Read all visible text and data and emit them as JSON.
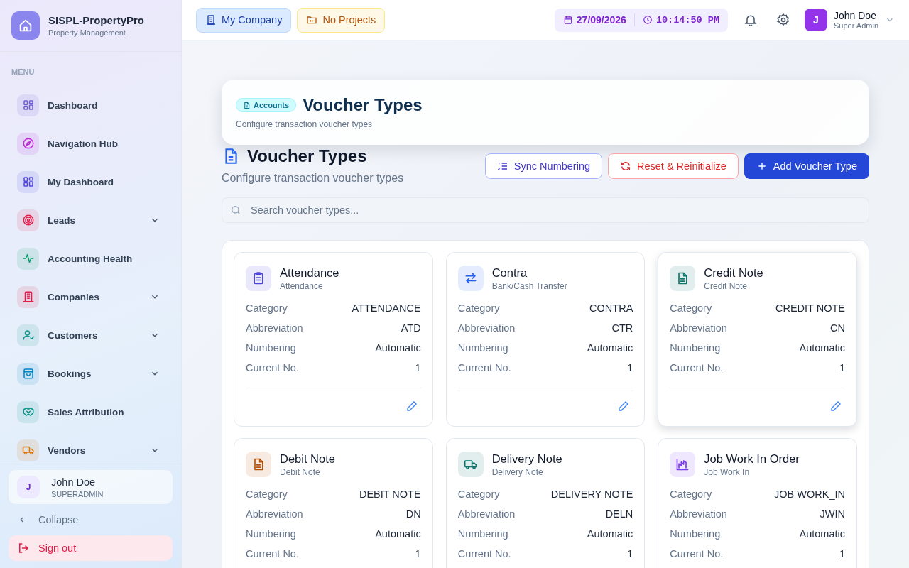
{
  "brand": {
    "name": "SISPL-PropertyPro",
    "subtitle": "Property Management"
  },
  "menu_label": "MENU",
  "sidebar": {
    "items": [
      {
        "label": "Dashboard",
        "color": "#6d5bd0",
        "expandable": false
      },
      {
        "label": "Navigation Hub",
        "color": "#c026d3",
        "expandable": false
      },
      {
        "label": "My Dashboard",
        "color": "#4f46e5",
        "expandable": false
      },
      {
        "label": "Leads",
        "color": "#e11d48",
        "expandable": true
      },
      {
        "label": "Accounting Health",
        "color": "#059669",
        "expandable": false
      },
      {
        "label": "Companies",
        "color": "#e11d48",
        "expandable": true
      },
      {
        "label": "Customers",
        "color": "#0d9488",
        "expandable": true
      },
      {
        "label": "Bookings",
        "color": "#0284c7",
        "expandable": true
      },
      {
        "label": "Sales Attribution",
        "color": "#0d9488",
        "expandable": false
      },
      {
        "label": "Vendors",
        "color": "#d97706",
        "expandable": true
      }
    ]
  },
  "sidebar_user": {
    "initial": "J",
    "name": "John Doe",
    "role": "SUPERADMIN"
  },
  "collapse": "Collapse",
  "sign_out": "Sign out",
  "topbar": {
    "company": "My Company",
    "project": "No Projects",
    "date": "27/09/2026",
    "time": "10:14:50 PM",
    "user": {
      "initial": "J",
      "name": "John Doe",
      "role": "Super Admin"
    }
  },
  "header_card": {
    "badge": "Accounts",
    "title": "Voucher Types",
    "subtitle": "Configure transaction voucher types"
  },
  "page": {
    "title": "Voucher Types",
    "subtitle": "Configure transaction voucher types",
    "buttons": [
      "Sync Numbering",
      "Reset & Reinitialize",
      "Add Voucher Type"
    ],
    "search": {
      "placeholder": "Search voucher types..."
    }
  },
  "vouchers": [
    {
      "name": "Attendance",
      "subtitle": "Attendance",
      "color": "#4f46e5",
      "highlighted": false,
      "fields": [
        {
          "label": "Category",
          "value": "ATTENDANCE"
        },
        {
          "label": "Abbreviation",
          "value": "ATD"
        },
        {
          "label": "Numbering",
          "value": "Automatic"
        },
        {
          "label": "Current No.",
          "value": "1"
        }
      ]
    },
    {
      "name": "Contra",
      "subtitle": "Bank/Cash Transfer",
      "color": "#2563eb",
      "highlighted": false,
      "fields": [
        {
          "label": "Category",
          "value": "CONTRA"
        },
        {
          "label": "Abbreviation",
          "value": "CTR"
        },
        {
          "label": "Numbering",
          "value": "Automatic"
        },
        {
          "label": "Current No.",
          "value": "1"
        }
      ]
    },
    {
      "name": "Credit Note",
      "subtitle": "Credit Note",
      "color": "#0f766e",
      "highlighted": true,
      "fields": [
        {
          "label": "Category",
          "value": "CREDIT NOTE"
        },
        {
          "label": "Abbreviation",
          "value": "CN"
        },
        {
          "label": "Numbering",
          "value": "Automatic"
        },
        {
          "label": "Current No.",
          "value": "1"
        }
      ]
    },
    {
      "name": "Debit Note",
      "subtitle": "Debit Note",
      "color": "#b45309",
      "highlighted": false,
      "fields": [
        {
          "label": "Category",
          "value": "DEBIT NOTE"
        },
        {
          "label": "Abbreviation",
          "value": "DN"
        },
        {
          "label": "Numbering",
          "value": "Automatic"
        },
        {
          "label": "Current No.",
          "value": "1"
        }
      ]
    },
    {
      "name": "Delivery Note",
      "subtitle": "Delivery Note",
      "color": "#0f766e",
      "highlighted": false,
      "fields": [
        {
          "label": "Category",
          "value": "DELIVERY NOTE"
        },
        {
          "label": "Abbreviation",
          "value": "DELN"
        },
        {
          "label": "Numbering",
          "value": "Automatic"
        },
        {
          "label": "Current No.",
          "value": "1"
        }
      ]
    },
    {
      "name": "Job Work In Order",
      "subtitle": "Job Work In",
      "color": "#7c3aed",
      "highlighted": false,
      "fields": [
        {
          "label": "Category",
          "value": "JOB WORK_IN"
        },
        {
          "label": "Abbreviation",
          "value": "JWIN"
        },
        {
          "label": "Numbering",
          "value": "Automatic"
        },
        {
          "label": "Current No.",
          "value": "1"
        }
      ]
    }
  ]
}
